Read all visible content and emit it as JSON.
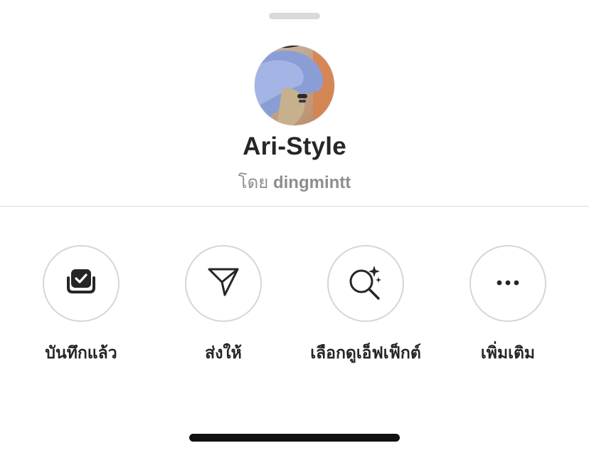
{
  "collection": {
    "title": "Ari-Style",
    "by_prefix": "โดย",
    "author": "dingmintt"
  },
  "actions": [
    {
      "label": "บันทึกแล้ว",
      "icon": "saved-check-icon"
    },
    {
      "label": "ส่งให้",
      "icon": "send-icon"
    },
    {
      "label": "เลือกดูเอ็ฟเฟ็กต์",
      "icon": "browse-effects-icon"
    },
    {
      "label": "เพิ่มเติม",
      "icon": "more-icon"
    }
  ],
  "colors": {
    "text_primary": "#262626",
    "text_secondary": "#8e8e8e",
    "circle_border": "#d6d6d6",
    "divider": "#dbdbdb"
  }
}
